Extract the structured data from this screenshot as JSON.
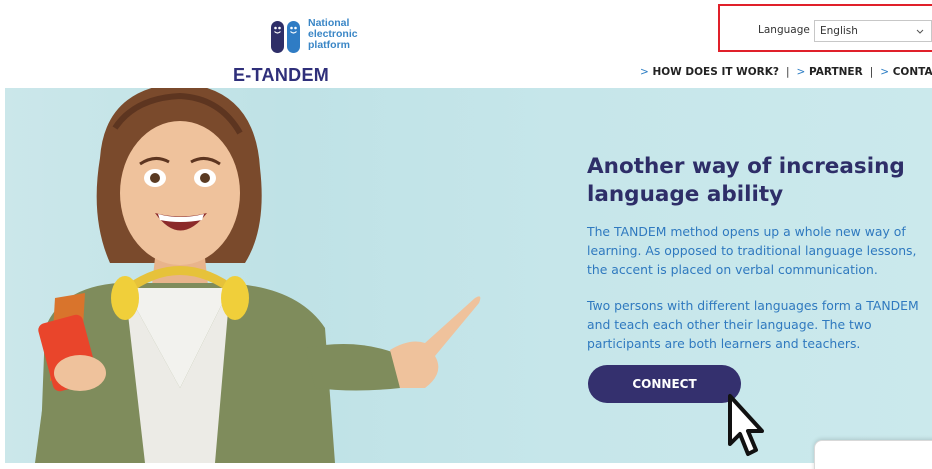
{
  "header": {
    "logo": {
      "line1": "National",
      "line2": "electronic",
      "line3": "platform",
      "brand": "E-TANDEM"
    },
    "language": {
      "label": "Language",
      "selected": "English"
    },
    "nav": [
      {
        "arrow": ">",
        "label": "HOW DOES IT WORK?"
      },
      {
        "arrow": ">",
        "label": "PARTNER"
      },
      {
        "arrow": ">",
        "label": "CONTACT US"
      }
    ],
    "nav_separator": "|"
  },
  "hero": {
    "title": "Another way of increasing language ability",
    "paragraph1": "The TANDEM method opens up a whole new way of learning. As opposed to traditional language lessons, the accent is placed on verbal communication.",
    "paragraph2": "Two persons with different languages form a TANDEM and teach each other their language. The two participants are both learners and teachers.",
    "cta_label": "CONNECT"
  },
  "colors": {
    "brand_navy": "#2e2e68",
    "link_blue": "#2f79bf",
    "button_bg": "#34306e",
    "hero_bg": "#c6e6ea",
    "highlight_border": "#e0202a"
  },
  "icons": {
    "language_dropdown": "chevron-down-icon",
    "pointer": "hand-cursor-icon"
  }
}
